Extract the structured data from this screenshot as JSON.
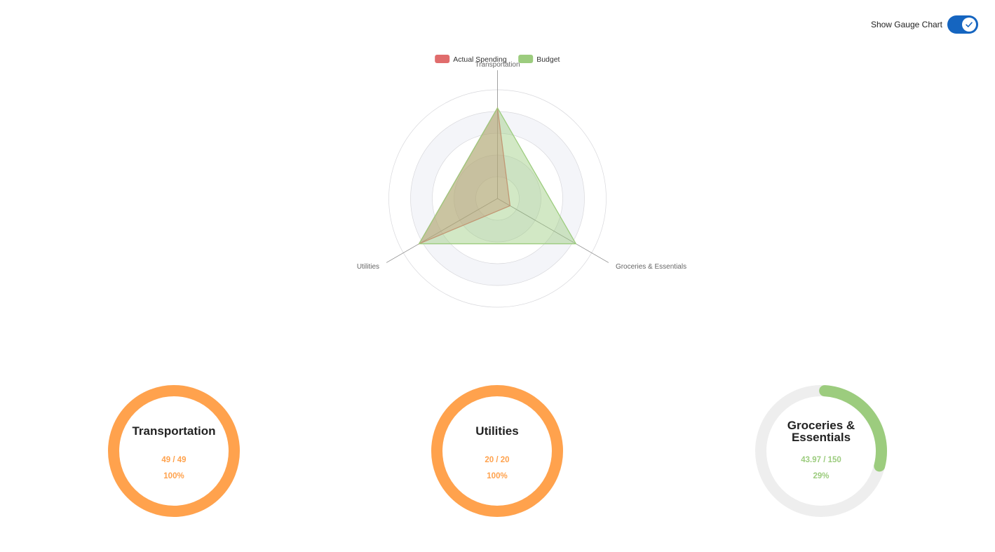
{
  "toggle": {
    "label": "Show Gauge Chart",
    "checked": true,
    "color": "#1565c0"
  },
  "chart_data": {
    "type": "radar",
    "axes": [
      "Transportation",
      "Groceries & Essentials",
      "Utilities"
    ],
    "range": [
      0,
      150
    ],
    "series": [
      {
        "name": "Actual Spending",
        "color": "#e06c6c",
        "values": [
          125,
          20,
          125
        ]
      },
      {
        "name": "Budget",
        "color": "#9ccc7e",
        "values": [
          125,
          125,
          125
        ]
      }
    ],
    "legend_position": "top-center"
  },
  "gauges": [
    {
      "title": "Transportation",
      "ratio": "49 / 49",
      "percent_label": "100%",
      "fraction": 1.0,
      "color": "#ffa24d"
    },
    {
      "title": "Utilities",
      "ratio": "20 / 20",
      "percent_label": "100%",
      "fraction": 1.0,
      "color": "#ffa24d"
    },
    {
      "title": "Groceries & Essentials",
      "ratio": "43.97 / 150",
      "percent_label": "29%",
      "fraction": 0.29,
      "color": "#9ccc7e"
    }
  ],
  "gauge_track_color": "#eeeeee"
}
